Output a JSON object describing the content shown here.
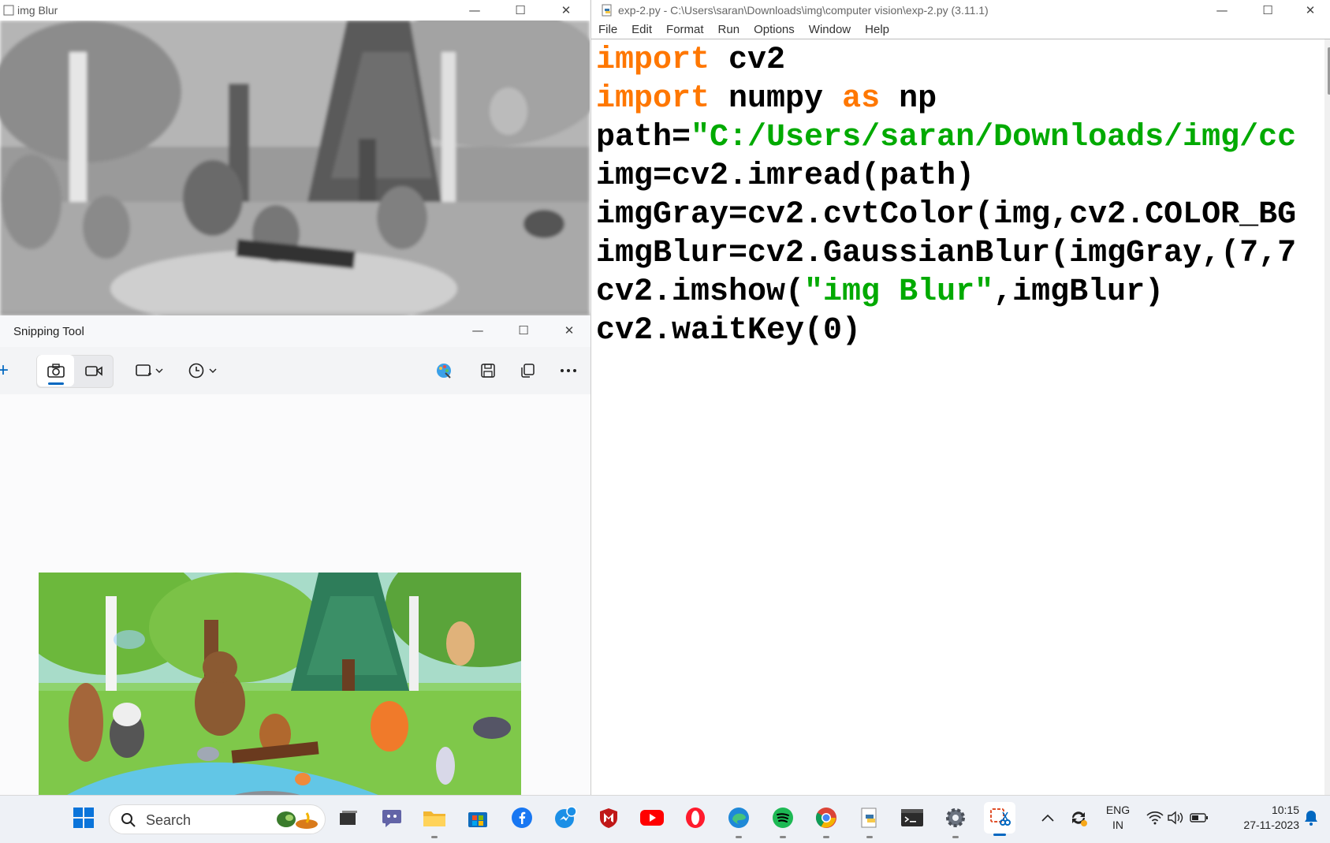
{
  "blur_window": {
    "title": "img Blur",
    "controls": {
      "minimize": "—",
      "maximize": "☐",
      "close": "✕"
    }
  },
  "snipping_tool": {
    "title": "Snipping Tool",
    "controls": {
      "minimize": "—",
      "maximize": "☐",
      "close": "✕"
    },
    "new_label": "+"
  },
  "idle": {
    "title": "exp-2.py - C:\\Users\\saran\\Downloads\\img\\computer vision\\exp-2.py (3.11.1)",
    "controls": {
      "minimize": "—",
      "maximize": "☐",
      "close": "✕"
    },
    "menu": [
      "File",
      "Edit",
      "Format",
      "Run",
      "Options",
      "Window",
      "Help"
    ],
    "code": {
      "l1_kw": "import",
      "l1_rest": " cv2",
      "l2_kw": "import",
      "l2_a": " numpy ",
      "l2_kw2": "as",
      "l2_b": " np",
      "l3_a": "path=",
      "l3_str": "\"C:/Users/saran/Downloads/img/cc",
      "l4": "img=cv2.imread(path)",
      "l5": "imgGray=cv2.cvtColor(img,cv2.COLOR_BG",
      "l6": "imgBlur=cv2.GaussianBlur(imgGray,(7,7",
      "l7_a": "cv2.imshow(",
      "l7_str": "\"img Blur\"",
      "l7_b": ",imgBlur)",
      "l8": "cv2.waitKey(0)"
    }
  },
  "taskbar": {
    "search_placeholder": "Search",
    "lang_top": "ENG",
    "lang_bottom": "IN",
    "time": "10:15",
    "date": "27-11-2023",
    "colors": {
      "accent": "#0067c0"
    }
  }
}
